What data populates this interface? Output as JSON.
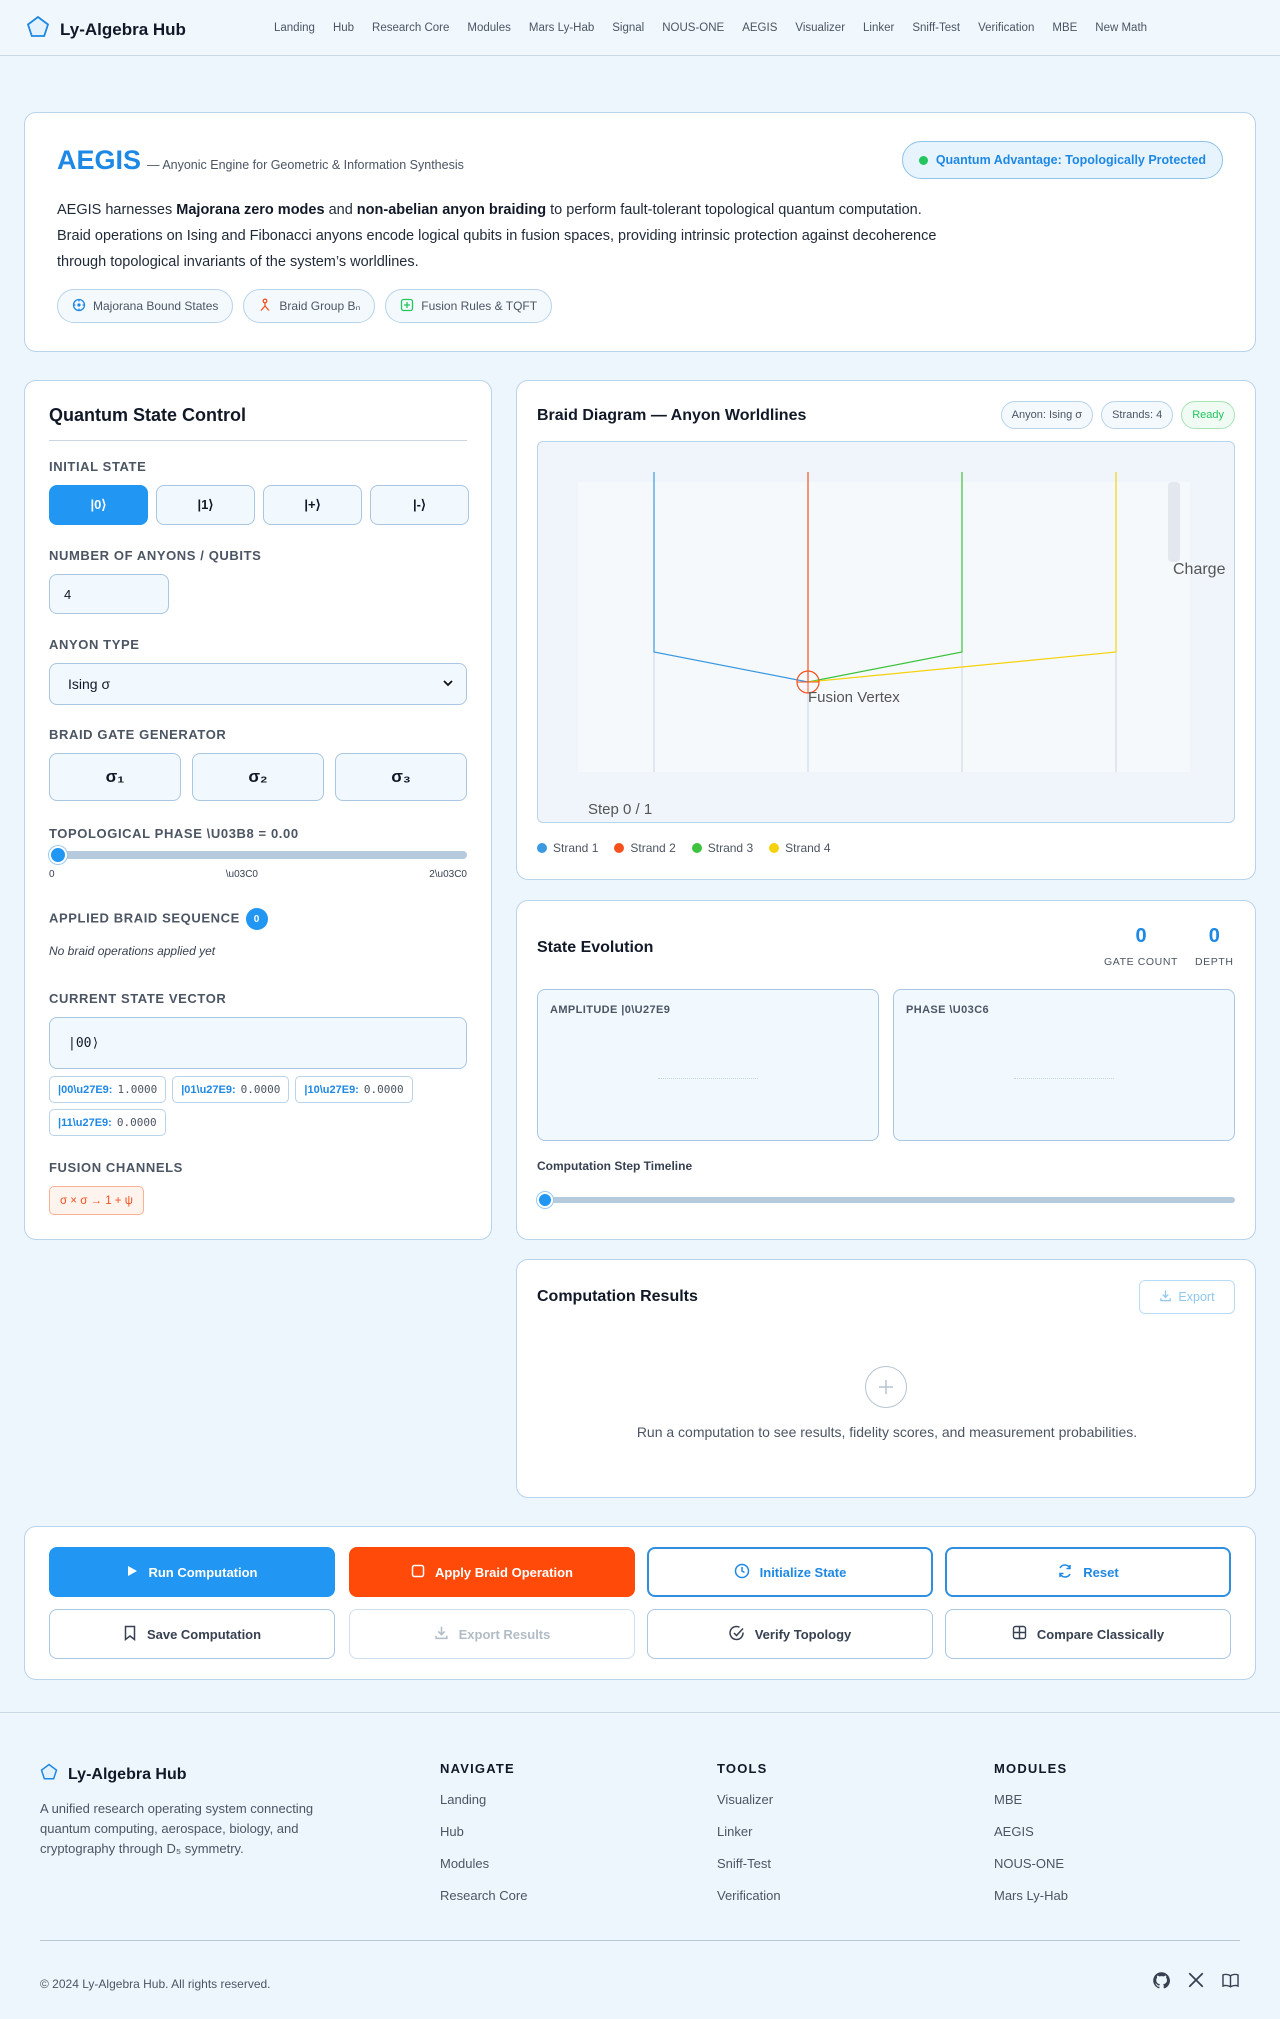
{
  "nav": {
    "brand": "Ly-Algebra Hub",
    "links": [
      "Landing",
      "Hub",
      "Research Core",
      "Modules",
      "Mars Ly-Hab",
      "Signal",
      "NOUS-ONE",
      "AEGIS",
      "Visualizer",
      "Linker",
      "Sniff-Test",
      "Verification",
      "MBE",
      "New Math"
    ]
  },
  "hero": {
    "title": "AEGIS",
    "subtitle": "— Anyonic Engine for Geometric & Information Synthesis",
    "desc_1": "AEGIS harnesses ",
    "desc_b1": "Majorana zero modes",
    "desc_2": " and ",
    "desc_b2": "non-abelian anyon braiding",
    "desc_3": " to perform fault-tolerant topological quantum computation. Braid operations on Ising and Fibonacci anyons encode logical qubits in fusion spaces, providing intrinsic protection against decoherence through topological invariants of the system’s worldlines.",
    "badge": "Quantum Advantage: Topologically Protected",
    "pills": [
      "Majorana Bound States",
      "Braid Group Bₙ",
      "Fusion Rules & TQFT"
    ]
  },
  "control": {
    "title": "Quantum State Control",
    "initial_state_label": "INITIAL STATE",
    "states": [
      "|0⟩",
      "|1⟩",
      "|+⟩",
      "|-⟩"
    ],
    "num_label": "NUMBER OF ANYONS / QUBITS",
    "num_value": "4",
    "anyon_label": "ANYON TYPE",
    "anyon_value": "Ising σ",
    "gate_label": "BRAID GATE GENERATOR",
    "gates": [
      "σ₁",
      "σ₂",
      "σ₃"
    ],
    "phase_label": "TOPOLOGICAL PHASE \\U03B8 = 0.00",
    "phase_value": 0,
    "ticks": [
      "0",
      "\\u03C0",
      "2\\u03C0"
    ],
    "seq_label": "APPLIED BRAID SEQUENCE",
    "seq_count": "0",
    "seq_empty": "No braid operations applied yet",
    "vec_label": "CURRENT STATE VECTOR",
    "vec_value": "|00⟩",
    "amps": [
      {
        "k": "|00\\u27E9:",
        "v": "1.0000"
      },
      {
        "k": "|01\\u27E9:",
        "v": "0.0000"
      },
      {
        "k": "|10\\u27E9:",
        "v": "0.0000"
      },
      {
        "k": "|11\\u27E9:",
        "v": "0.0000"
      }
    ],
    "fusion_label": "FUSION CHANNELS",
    "fusion_value": "σ × σ → 1 + ψ"
  },
  "braid": {
    "title": "Braid Diagram — Anyon Worldlines",
    "badges": [
      "Anyon: Ising σ",
      "Strands: 4",
      "Ready"
    ],
    "charge_label": "Charge",
    "vertex_label": "Fusion Vertex",
    "step_label": "Step 0 / 1",
    "legend": [
      "Strand 1",
      "Strand 2",
      "Strand 3",
      "Strand 4"
    ],
    "colors": [
      "#3b99e0",
      "#f4511e",
      "#3cc23c",
      "#f5d20d"
    ]
  },
  "evolution": {
    "title": "State Evolution",
    "gate_count": "0",
    "gate_count_label": "GATE COUNT",
    "depth": "0",
    "depth_label": "DEPTH",
    "amp_label": "AMPLITUDE |0\\U27E9",
    "phase_label": "PHASE \\U03C6",
    "timeline_label": "Computation Step Timeline",
    "timeline_value": 0
  },
  "results": {
    "title": "Computation Results",
    "export_label": "Export",
    "message": "Run a computation to see results, fidelity scores, and measurement probabilities."
  },
  "actions": {
    "run": "Run Computation",
    "apply": "Apply Braid Operation",
    "init": "Initialize State",
    "reset": "Reset",
    "save": "Save Computation",
    "export": "Export Results",
    "verify": "Verify Topology",
    "compare": "Compare Classically"
  },
  "footer": {
    "brand": "Ly-Algebra Hub",
    "desc": "A unified research operating system connecting quantum computing, aerospace, biology, and cryptography through D₅ symmetry.",
    "navigate_h": "NAVIGATE",
    "navigate": [
      "Landing",
      "Hub",
      "Modules",
      "Research Core"
    ],
    "tools_h": "TOOLS",
    "tools": [
      "Visualizer",
      "Linker",
      "Sniff-Test",
      "Verification"
    ],
    "modules_h": "MODULES",
    "modules": [
      "MBE",
      "AEGIS",
      "NOUS-ONE",
      "Mars Ly-Hab"
    ],
    "copyright": "© 2024 Ly-Algebra Hub. All rights reserved."
  }
}
